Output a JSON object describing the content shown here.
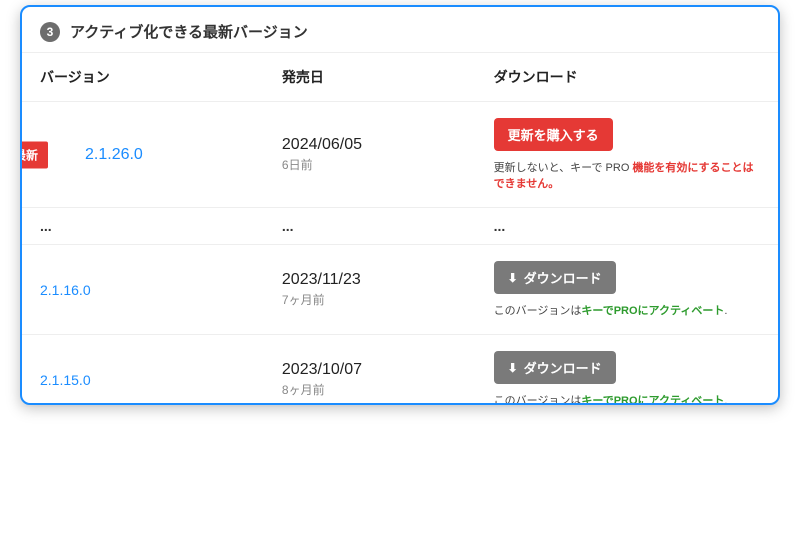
{
  "header": {
    "step": "3",
    "title": "アクティブ化できる最新バージョン"
  },
  "columns": {
    "version": "バージョン",
    "release": "発売日",
    "download": "ダウンロード"
  },
  "rows": {
    "latest": {
      "ribbon": "最新",
      "version": "2.1.26.0",
      "date": "2024/06/05",
      "ago": "6日前",
      "button": "更新を購入する",
      "note_prefix": "更新しないと、キーで PRO ",
      "note_highlight": "機能を有効にすることはできません。"
    },
    "ellipsis": "...",
    "r2": {
      "version": "2.1.16.0",
      "date": "2023/11/23",
      "ago": "7ヶ月前",
      "button": "ダウンロード",
      "note_prefix": "このバージョンは",
      "note_highlight": "キーでPROにアクティベート",
      "note_suffix": "."
    },
    "r3": {
      "version": "2.1.15.0",
      "date": "2023/10/07",
      "ago": "8ヶ月前",
      "button": "ダウンロード",
      "note_prefix": "このバージョンは",
      "note_highlight": "キーでPROにアクティベート",
      "note_suffix": "."
    }
  }
}
